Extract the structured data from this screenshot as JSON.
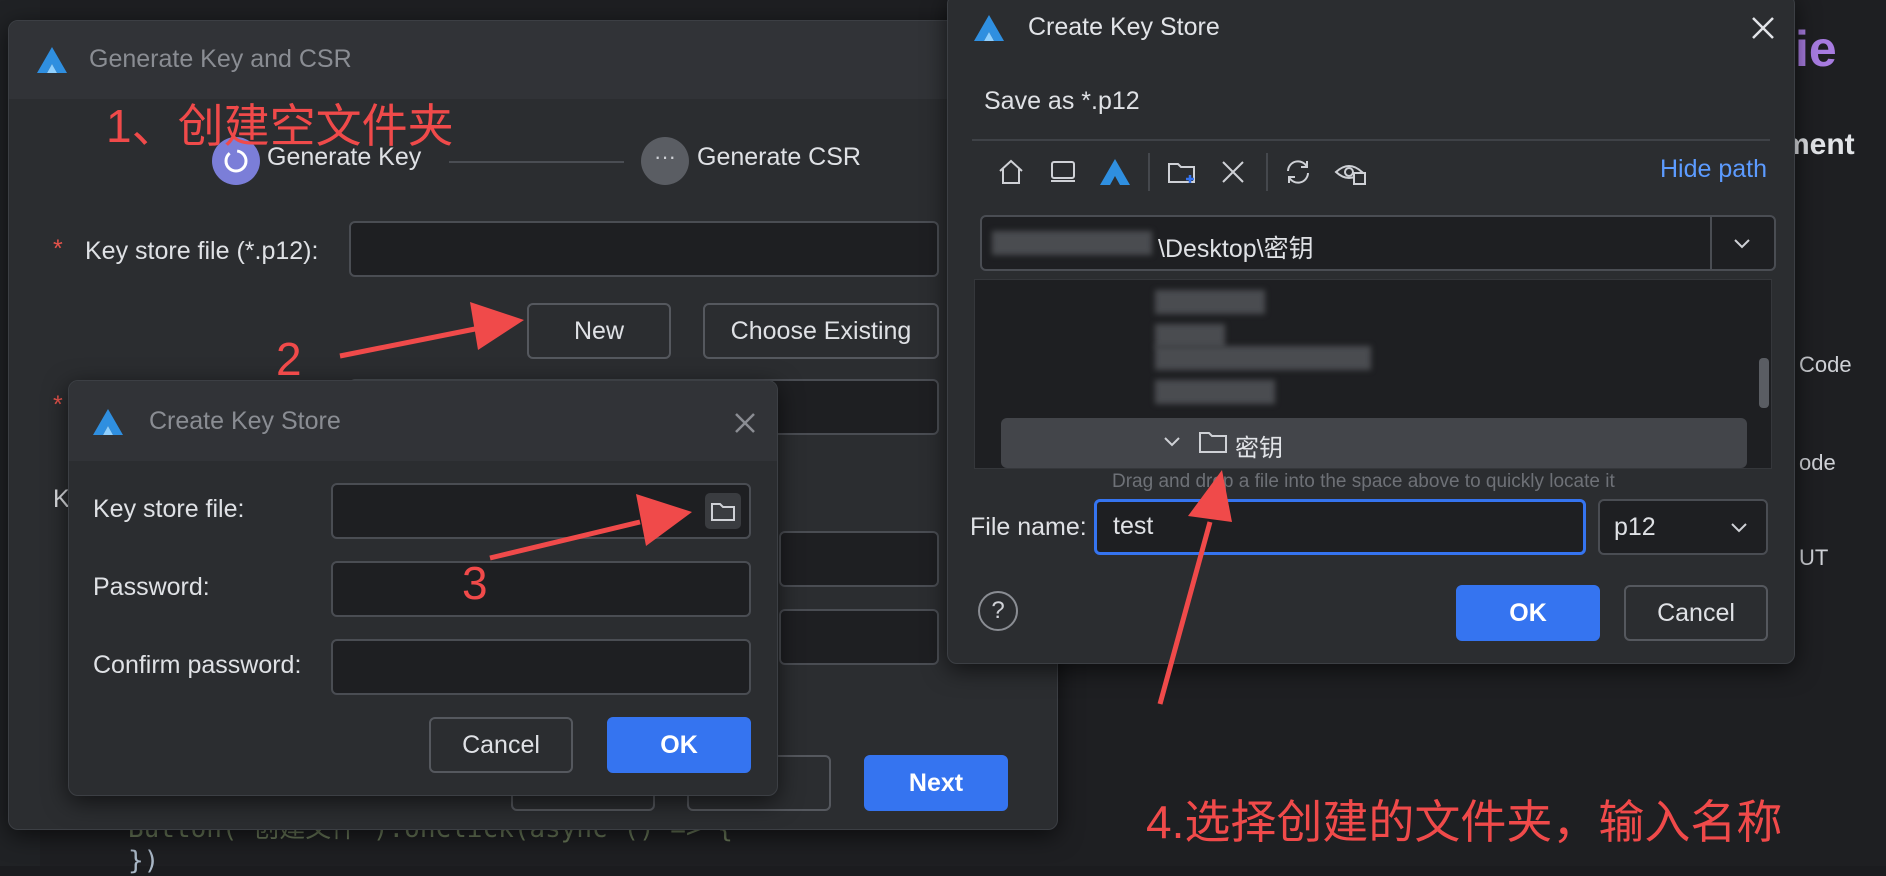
{
  "colors": {
    "accent": "#3574f0",
    "annotation": "#f04a4a",
    "required": "#e5534b"
  },
  "gen_dialog": {
    "title": "Generate Key and CSR",
    "steps": [
      {
        "label": "Generate Key"
      },
      {
        "label": "Generate CSR"
      }
    ],
    "key_store_label": "Key store file (*.p12):",
    "new_label": "New",
    "choose_existing_label": "Choose Existing",
    "next_label": "Next",
    "side_letter": "K"
  },
  "small_dialog": {
    "title": "Create Key Store",
    "key_store_label": "Key store file:",
    "password_label": "Password:",
    "confirm_label": "Confirm password:",
    "cancel_label": "Cancel",
    "ok_label": "OK"
  },
  "file_dialog": {
    "title": "Create Key Store",
    "subtitle": "Save as *.p12",
    "hide_path_label": "Hide path",
    "path_value": "\\Desktop\\密钥",
    "tree_folder_label": "密钥",
    "drag_hint": "Drag and drop a file into the space above to quickly locate it",
    "filename_label": "File name:",
    "filename_value": "test",
    "ext_value": "p12",
    "ok_label": "OK",
    "cancel_label": "Cancel",
    "help_label": "?"
  },
  "annotations": {
    "a1": "1、创建空文件夹",
    "a2": "2",
    "a3": "3",
    "a4": "4.选择创建的文件夹，输入名称"
  },
  "right_panel": {
    "partial_title": "ie",
    "partial_heading": "ment",
    "item1": "Code",
    "item2": "ode",
    "item3": "UT"
  },
  "background_code": {
    "line1": "Button('创建文件').onClick(async () => {",
    "line2": "})"
  }
}
